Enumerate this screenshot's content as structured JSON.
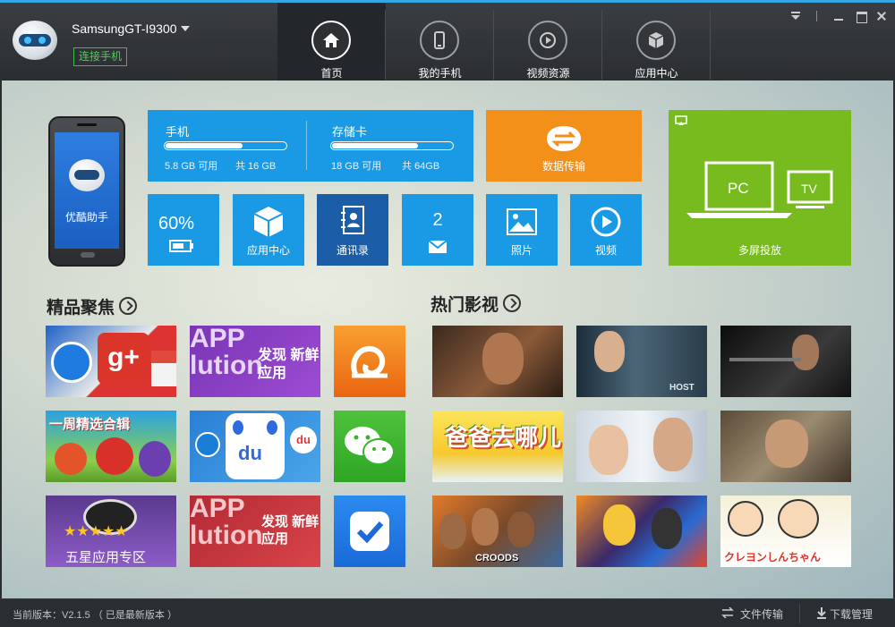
{
  "app": {
    "device_name": "SamsungGT-I9300",
    "connect_label": "连接手机"
  },
  "nav": {
    "tabs": [
      {
        "label": "首页",
        "icon": "home-icon",
        "active": true
      },
      {
        "label": "我的手机",
        "icon": "phone-icon",
        "active": false
      },
      {
        "label": "视频资源",
        "icon": "play-icon",
        "active": false
      },
      {
        "label": "应用中心",
        "icon": "box-icon",
        "active": false
      }
    ]
  },
  "phone_preview": {
    "app_name": "优酷助手"
  },
  "storage": {
    "phone": {
      "title": "手机",
      "available": "5.8 GB 可用",
      "total": "共 16 GB",
      "used_fraction": 0.64
    },
    "card": {
      "title": "存储卡",
      "available": "18 GB 可用",
      "total": "共 64GB",
      "used_fraction": 0.72
    }
  },
  "tiles": {
    "data_transfer": "数据传输",
    "multi_screen": "多屏投放",
    "pc_label": "PC",
    "tv_label": "TV",
    "battery": "60%",
    "app_center": "应用中心",
    "contacts": "通讯录",
    "sms_count": "2",
    "photos": "照片",
    "video": "视频"
  },
  "sections": {
    "featured": "精品聚焦",
    "hot_video": "热门影视"
  },
  "featured_items": [
    {
      "caption": "",
      "icon": "google-plus-icon"
    },
    {
      "caption": "发现 新鲜应用",
      "icon": "app-evolution-banner"
    },
    {
      "caption": "",
      "icon": "uc-browser-icon"
    },
    {
      "caption": "一周精选合辑",
      "icon": "weekly-picks-banner"
    },
    {
      "caption": "",
      "icon": "baidu-map-icon"
    },
    {
      "caption": "",
      "icon": "wechat-icon"
    },
    {
      "caption": "五星应用专区",
      "icon": "five-star-banner"
    },
    {
      "caption": "发现 新鲜应用",
      "icon": "app-evolution-banner"
    },
    {
      "caption": "",
      "icon": "checkmark-app-icon"
    }
  ],
  "hot_videos": [
    {
      "caption": ""
    },
    {
      "caption": "HOST"
    },
    {
      "caption": ""
    },
    {
      "caption": "爸爸去哪儿"
    },
    {
      "caption": ""
    },
    {
      "caption": ""
    },
    {
      "caption": "CROODS"
    },
    {
      "caption": ""
    },
    {
      "caption": "クレヨンしんちゃん"
    }
  ],
  "status": {
    "version": "当前版本：V2.1.5 （ 已是最新版本 ）",
    "file_transfer": "文件传输",
    "download_manager": "下载管理"
  }
}
